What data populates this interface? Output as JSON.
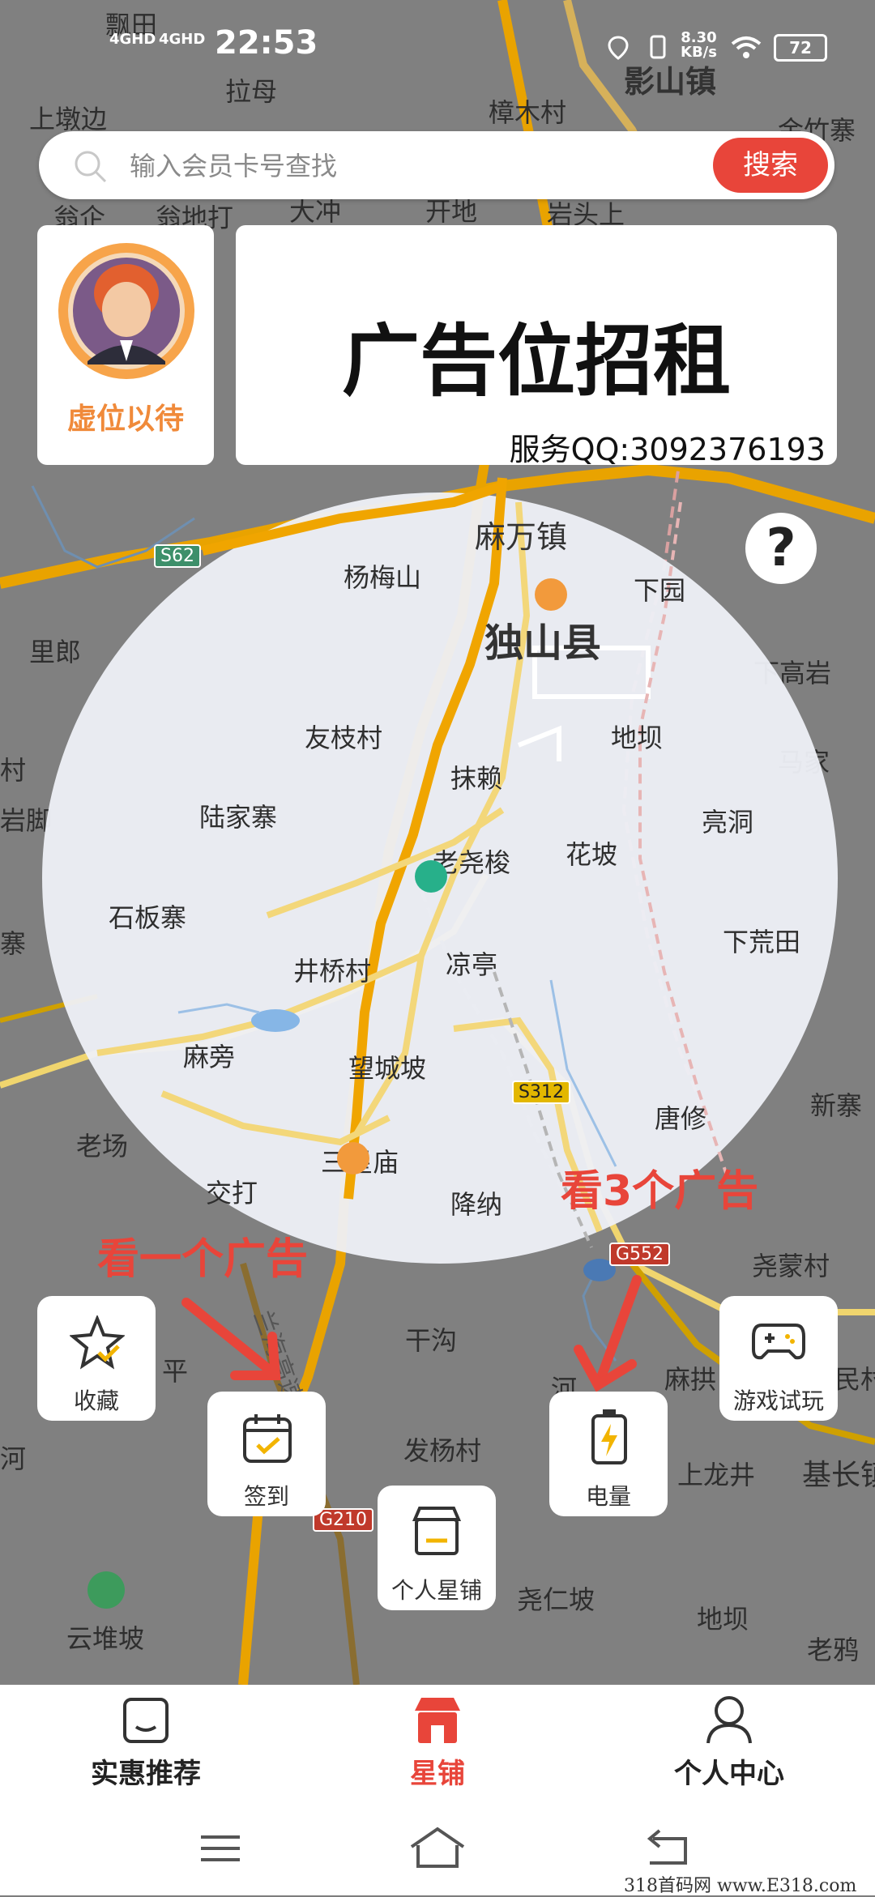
{
  "status_bar": {
    "time": "22:53",
    "signal1": "4GHD",
    "signal2": "4GHD",
    "speed_value": "8.30",
    "speed_unit": "KB/s",
    "battery": "72"
  },
  "search": {
    "placeholder": "输入会员卡号查找",
    "button_label": "搜索"
  },
  "avatar_card": {
    "name": "虚位以待"
  },
  "ad_card": {
    "title": "广告位招租",
    "qq": "服务QQ:3092376193"
  },
  "help_button": "?",
  "map": {
    "labels": [
      {
        "text": "飘田"
      },
      {
        "text": "拉母"
      },
      {
        "text": "上墩边"
      },
      {
        "text": "樟木村"
      },
      {
        "text": "影山镇"
      },
      {
        "text": "金竹寨"
      },
      {
        "text": "翁企"
      },
      {
        "text": "翁地打"
      },
      {
        "text": "大冲"
      },
      {
        "text": "开地"
      },
      {
        "text": "岩头上"
      },
      {
        "text": "麻万镇"
      },
      {
        "text": "杨梅山"
      },
      {
        "text": "下园"
      },
      {
        "text": "独山县"
      },
      {
        "text": "里郎"
      },
      {
        "text": "下高岩"
      },
      {
        "text": "友枝村"
      },
      {
        "text": "地坝"
      },
      {
        "text": "马家"
      },
      {
        "text": "抹赖"
      },
      {
        "text": "陆家寨"
      },
      {
        "text": "亮洞"
      },
      {
        "text": "老尧梭"
      },
      {
        "text": "花坡"
      },
      {
        "text": "石板寨"
      },
      {
        "text": "下荒田"
      },
      {
        "text": "井桥村"
      },
      {
        "text": "凉亭"
      },
      {
        "text": "麻旁"
      },
      {
        "text": "望城坡"
      },
      {
        "text": "新寨"
      },
      {
        "text": "唐修"
      },
      {
        "text": "老场"
      },
      {
        "text": "三星庙"
      },
      {
        "text": "交打"
      },
      {
        "text": "降纳"
      },
      {
        "text": "尧蒙村"
      },
      {
        "text": "干沟"
      },
      {
        "text": "平"
      },
      {
        "text": "河"
      },
      {
        "text": "麻拱"
      },
      {
        "text": "民村"
      },
      {
        "text": "发杨村"
      },
      {
        "text": "上龙井"
      },
      {
        "text": "基长镇"
      },
      {
        "text": "云堆坡"
      },
      {
        "text": "尧仁坡"
      },
      {
        "text": "地坝"
      },
      {
        "text": "老鸦"
      },
      {
        "text": "兰海高速"
      },
      {
        "text": "村"
      },
      {
        "text": "岩脚"
      },
      {
        "text": "寨"
      },
      {
        "text": "河"
      }
    ],
    "road_badges": [
      "S62",
      "S312",
      "G552",
      "G210"
    ]
  },
  "annotations": {
    "left": "看一个广告",
    "right": "看3个广告"
  },
  "fabs": {
    "favorite": "收藏",
    "checkin": "签到",
    "shop": "个人星铺",
    "battery": "电量",
    "game": "游戏试玩"
  },
  "tabs": [
    {
      "label": "实惠推荐"
    },
    {
      "label": "星铺"
    },
    {
      "label": "个人中心"
    }
  ],
  "watermark": "318首码网 www.E318.com",
  "colors": {
    "accent": "#e8453a",
    "avatar_name": "#f08a3a"
  }
}
